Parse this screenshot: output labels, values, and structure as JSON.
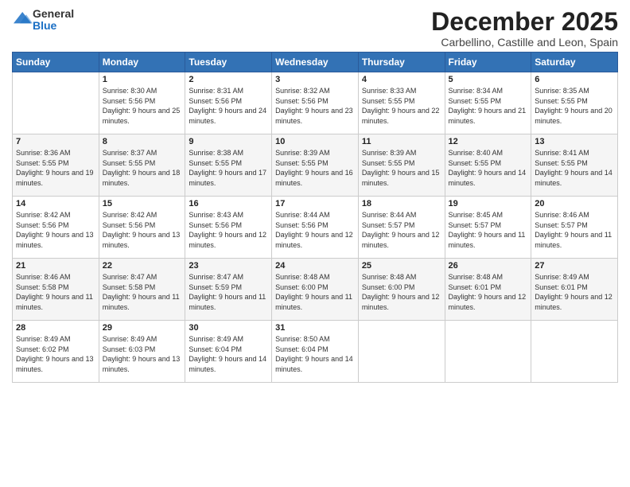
{
  "logo": {
    "general": "General",
    "blue": "Blue"
  },
  "title": "December 2025",
  "subtitle": "Carbellino, Castille and Leon, Spain",
  "days_of_week": [
    "Sunday",
    "Monday",
    "Tuesday",
    "Wednesday",
    "Thursday",
    "Friday",
    "Saturday"
  ],
  "weeks": [
    [
      {
        "day": "",
        "sunrise": "",
        "sunset": "",
        "daylight": ""
      },
      {
        "day": "1",
        "sunrise": "Sunrise: 8:30 AM",
        "sunset": "Sunset: 5:56 PM",
        "daylight": "Daylight: 9 hours and 25 minutes."
      },
      {
        "day": "2",
        "sunrise": "Sunrise: 8:31 AM",
        "sunset": "Sunset: 5:56 PM",
        "daylight": "Daylight: 9 hours and 24 minutes."
      },
      {
        "day": "3",
        "sunrise": "Sunrise: 8:32 AM",
        "sunset": "Sunset: 5:56 PM",
        "daylight": "Daylight: 9 hours and 23 minutes."
      },
      {
        "day": "4",
        "sunrise": "Sunrise: 8:33 AM",
        "sunset": "Sunset: 5:55 PM",
        "daylight": "Daylight: 9 hours and 22 minutes."
      },
      {
        "day": "5",
        "sunrise": "Sunrise: 8:34 AM",
        "sunset": "Sunset: 5:55 PM",
        "daylight": "Daylight: 9 hours and 21 minutes."
      },
      {
        "day": "6",
        "sunrise": "Sunrise: 8:35 AM",
        "sunset": "Sunset: 5:55 PM",
        "daylight": "Daylight: 9 hours and 20 minutes."
      }
    ],
    [
      {
        "day": "7",
        "sunrise": "Sunrise: 8:36 AM",
        "sunset": "Sunset: 5:55 PM",
        "daylight": "Daylight: 9 hours and 19 minutes."
      },
      {
        "day": "8",
        "sunrise": "Sunrise: 8:37 AM",
        "sunset": "Sunset: 5:55 PM",
        "daylight": "Daylight: 9 hours and 18 minutes."
      },
      {
        "day": "9",
        "sunrise": "Sunrise: 8:38 AM",
        "sunset": "Sunset: 5:55 PM",
        "daylight": "Daylight: 9 hours and 17 minutes."
      },
      {
        "day": "10",
        "sunrise": "Sunrise: 8:39 AM",
        "sunset": "Sunset: 5:55 PM",
        "daylight": "Daylight: 9 hours and 16 minutes."
      },
      {
        "day": "11",
        "sunrise": "Sunrise: 8:39 AM",
        "sunset": "Sunset: 5:55 PM",
        "daylight": "Daylight: 9 hours and 15 minutes."
      },
      {
        "day": "12",
        "sunrise": "Sunrise: 8:40 AM",
        "sunset": "Sunset: 5:55 PM",
        "daylight": "Daylight: 9 hours and 14 minutes."
      },
      {
        "day": "13",
        "sunrise": "Sunrise: 8:41 AM",
        "sunset": "Sunset: 5:55 PM",
        "daylight": "Daylight: 9 hours and 14 minutes."
      }
    ],
    [
      {
        "day": "14",
        "sunrise": "Sunrise: 8:42 AM",
        "sunset": "Sunset: 5:56 PM",
        "daylight": "Daylight: 9 hours and 13 minutes."
      },
      {
        "day": "15",
        "sunrise": "Sunrise: 8:42 AM",
        "sunset": "Sunset: 5:56 PM",
        "daylight": "Daylight: 9 hours and 13 minutes."
      },
      {
        "day": "16",
        "sunrise": "Sunrise: 8:43 AM",
        "sunset": "Sunset: 5:56 PM",
        "daylight": "Daylight: 9 hours and 12 minutes."
      },
      {
        "day": "17",
        "sunrise": "Sunrise: 8:44 AM",
        "sunset": "Sunset: 5:56 PM",
        "daylight": "Daylight: 9 hours and 12 minutes."
      },
      {
        "day": "18",
        "sunrise": "Sunrise: 8:44 AM",
        "sunset": "Sunset: 5:57 PM",
        "daylight": "Daylight: 9 hours and 12 minutes."
      },
      {
        "day": "19",
        "sunrise": "Sunrise: 8:45 AM",
        "sunset": "Sunset: 5:57 PM",
        "daylight": "Daylight: 9 hours and 11 minutes."
      },
      {
        "day": "20",
        "sunrise": "Sunrise: 8:46 AM",
        "sunset": "Sunset: 5:57 PM",
        "daylight": "Daylight: 9 hours and 11 minutes."
      }
    ],
    [
      {
        "day": "21",
        "sunrise": "Sunrise: 8:46 AM",
        "sunset": "Sunset: 5:58 PM",
        "daylight": "Daylight: 9 hours and 11 minutes."
      },
      {
        "day": "22",
        "sunrise": "Sunrise: 8:47 AM",
        "sunset": "Sunset: 5:58 PM",
        "daylight": "Daylight: 9 hours and 11 minutes."
      },
      {
        "day": "23",
        "sunrise": "Sunrise: 8:47 AM",
        "sunset": "Sunset: 5:59 PM",
        "daylight": "Daylight: 9 hours and 11 minutes."
      },
      {
        "day": "24",
        "sunrise": "Sunrise: 8:48 AM",
        "sunset": "Sunset: 6:00 PM",
        "daylight": "Daylight: 9 hours and 11 minutes."
      },
      {
        "day": "25",
        "sunrise": "Sunrise: 8:48 AM",
        "sunset": "Sunset: 6:00 PM",
        "daylight": "Daylight: 9 hours and 12 minutes."
      },
      {
        "day": "26",
        "sunrise": "Sunrise: 8:48 AM",
        "sunset": "Sunset: 6:01 PM",
        "daylight": "Daylight: 9 hours and 12 minutes."
      },
      {
        "day": "27",
        "sunrise": "Sunrise: 8:49 AM",
        "sunset": "Sunset: 6:01 PM",
        "daylight": "Daylight: 9 hours and 12 minutes."
      }
    ],
    [
      {
        "day": "28",
        "sunrise": "Sunrise: 8:49 AM",
        "sunset": "Sunset: 6:02 PM",
        "daylight": "Daylight: 9 hours and 13 minutes."
      },
      {
        "day": "29",
        "sunrise": "Sunrise: 8:49 AM",
        "sunset": "Sunset: 6:03 PM",
        "daylight": "Daylight: 9 hours and 13 minutes."
      },
      {
        "day": "30",
        "sunrise": "Sunrise: 8:49 AM",
        "sunset": "Sunset: 6:04 PM",
        "daylight": "Daylight: 9 hours and 14 minutes."
      },
      {
        "day": "31",
        "sunrise": "Sunrise: 8:50 AM",
        "sunset": "Sunset: 6:04 PM",
        "daylight": "Daylight: 9 hours and 14 minutes."
      },
      {
        "day": "",
        "sunrise": "",
        "sunset": "",
        "daylight": ""
      },
      {
        "day": "",
        "sunrise": "",
        "sunset": "",
        "daylight": ""
      },
      {
        "day": "",
        "sunrise": "",
        "sunset": "",
        "daylight": ""
      }
    ]
  ]
}
